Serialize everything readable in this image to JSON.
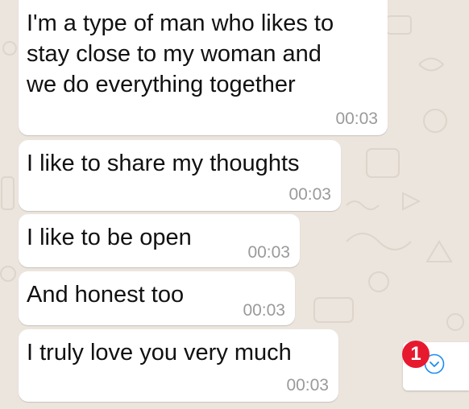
{
  "messages": [
    {
      "text": "I'm a type of man who likes to\nstay close to my woman and\nwe do everything together",
      "time": "00:03"
    },
    {
      "text": "I like to share my thoughts",
      "time": "00:03"
    },
    {
      "text": "I like to be open",
      "time": "00:03"
    },
    {
      "text": "And honest too",
      "time": "00:03"
    },
    {
      "text": "I truly love you very much",
      "time": "00:03"
    }
  ],
  "scroll_button": {
    "unread_count": "1",
    "icon": "chevron-down-icon"
  },
  "colors": {
    "wallpaper": "#ece5dd",
    "bubble": "#ffffff",
    "badge": "#e6192f",
    "accent": "#1d8cf0"
  }
}
